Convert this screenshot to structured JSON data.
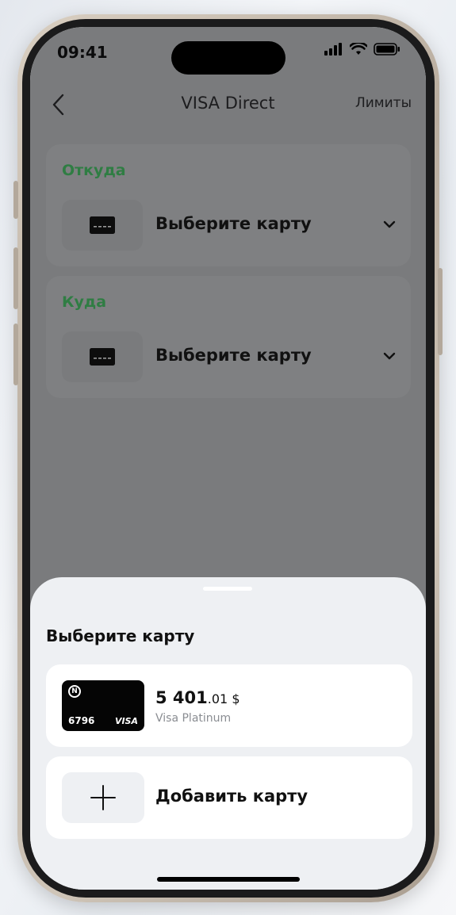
{
  "status": {
    "time": "09:41"
  },
  "nav": {
    "title": "VISA Direct",
    "limits": "Лимиты"
  },
  "from": {
    "label": "Откуда",
    "placeholder": "Выберите карту"
  },
  "to": {
    "label": "Куда",
    "placeholder": "Выберите карту"
  },
  "sheet": {
    "title": "Выберите карту",
    "card": {
      "last4": "6796",
      "brand": "VISA",
      "balance_int": "5 401",
      "balance_frac": ".01",
      "currency": "$",
      "name": "Visa Platinum"
    },
    "add_label": "Добавить карту"
  },
  "colors": {
    "accent_green": "#2f7d43",
    "overlay": "#7a7b7d",
    "sheet": "#eef0f3"
  }
}
